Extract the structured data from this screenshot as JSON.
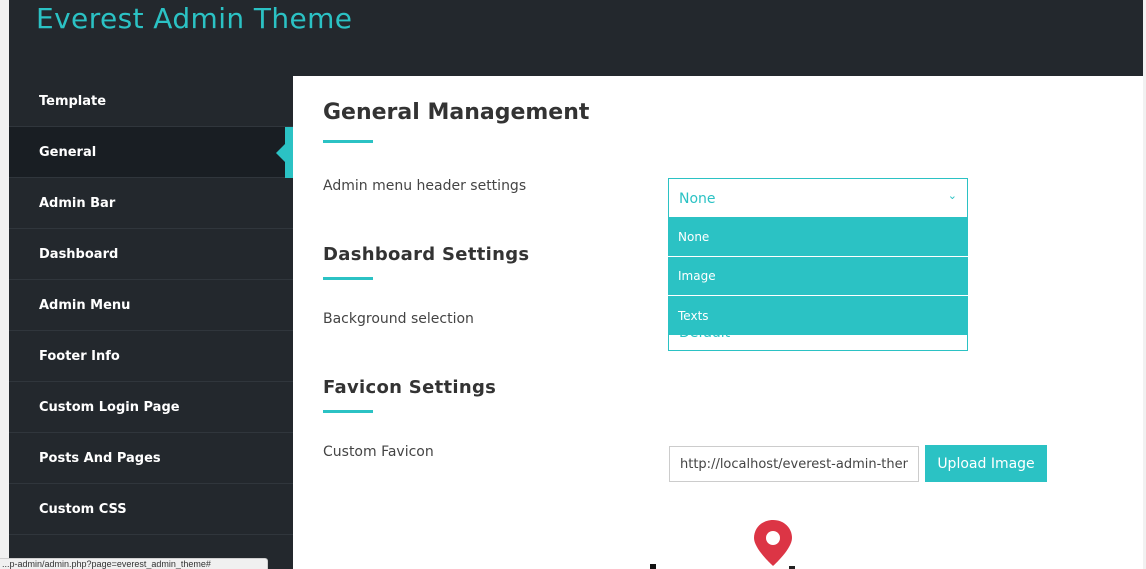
{
  "app": {
    "title": "Everest Admin Theme"
  },
  "sidebar": {
    "items": [
      {
        "label": "Template"
      },
      {
        "label": "General"
      },
      {
        "label": "Admin Bar"
      },
      {
        "label": "Dashboard"
      },
      {
        "label": "Admin Menu"
      },
      {
        "label": "Footer Info"
      },
      {
        "label": "Custom Login Page"
      },
      {
        "label": "Posts And Pages"
      },
      {
        "label": "Custom CSS"
      }
    ],
    "active_index": 1
  },
  "main": {
    "title": "General Management",
    "admin_menu_header": {
      "label": "Admin menu header settings",
      "selected": "None",
      "options": [
        "None",
        "Image",
        "Texts"
      ]
    },
    "dashboard": {
      "title": "Dashboard Settings",
      "background_label": "Background selection",
      "background_value": "Default"
    },
    "favicon": {
      "title": "Favicon Settings",
      "label": "Custom Favicon",
      "url_value": "http://localhost/everest-admin-theme",
      "upload_label": "Upload Image"
    }
  },
  "status_bar": {
    "url": "...p-admin/admin.php?page=everest_admin_theme#"
  },
  "colors": {
    "accent": "#2bc2c4",
    "sidebar_bg": "#23282d",
    "pin": "#dc3545"
  },
  "icons": {
    "select_arrow": "chevron-down-icon",
    "pin": "location-pin-icon"
  }
}
